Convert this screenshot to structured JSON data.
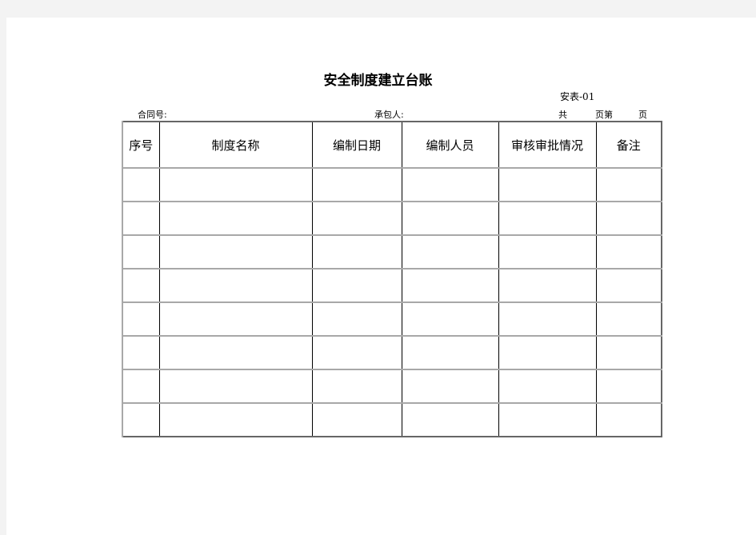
{
  "document": {
    "title": "安全制度建立台账",
    "form_code": "安表-01",
    "contract_no_label": "合同号:",
    "contractor_label": "承包人:",
    "total_pages_label": "共",
    "page_of_label": "页第",
    "page_label": "页"
  },
  "table": {
    "headers": [
      "序号",
      "制度名称",
      "编制日期",
      "编制人员",
      "审核审批情况",
      "备注"
    ],
    "rows": [
      [
        "",
        "",
        "",
        "",
        "",
        ""
      ],
      [
        "",
        "",
        "",
        "",
        "",
        ""
      ],
      [
        "",
        "",
        "",
        "",
        "",
        ""
      ],
      [
        "",
        "",
        "",
        "",
        "",
        ""
      ],
      [
        "",
        "",
        "",
        "",
        "",
        ""
      ],
      [
        "",
        "",
        "",
        "",
        "",
        ""
      ],
      [
        "",
        "",
        "",
        "",
        "",
        ""
      ],
      [
        "",
        "",
        "",
        "",
        "",
        ""
      ]
    ]
  }
}
